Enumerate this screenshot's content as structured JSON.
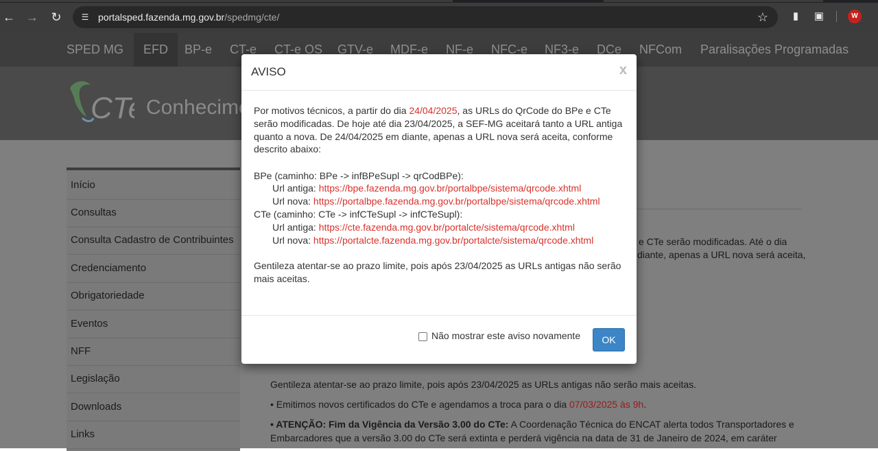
{
  "browser": {
    "url_host": "portalsped.fazenda.mg.gov.br",
    "url_path": "/spedmg/cte/",
    "avatar_letter": "W",
    "icons": [
      "back-icon",
      "forward-icon",
      "reload-icon",
      "site-settings-icon",
      "bookmark-star-icon",
      "extension-icon",
      "puzzle-icon"
    ]
  },
  "sitenav": {
    "items": [
      "SPED MG",
      "EFD",
      "BP-e",
      "CT-e",
      "CT-e OS",
      "GTV-e",
      "MDF-e",
      "NF-e",
      "NFC-e",
      "NF3-e",
      "DCe",
      "NFCom",
      "Paralisações Programadas"
    ]
  },
  "header": {
    "logo_text": "CTe",
    "title": "Conhecime"
  },
  "sidebar": {
    "items": [
      "Início",
      "Consultas",
      "Consulta Cadastro de Contribuintes",
      "Credenciamento",
      "Obrigatoriedade",
      "Eventos",
      "NFF",
      "Legislação",
      "Downloads",
      "Links"
    ]
  },
  "main": {
    "bg_line1": "e CTe serão modificadas. Até o dia",
    "bg_line2": "diante, apenas a URL nova será aceita,",
    "gentileza": "Gentileza atentar-se ao prazo limite, pois após 23/04/2025 as URLs antigas não serão mais aceitas.",
    "cert_prefix": "• Emitimos novos certificados do CTe e agendamos a troca para o dia ",
    "cert_date": "07/03/2025 às 9h",
    "cert_suffix": ".",
    "atencao_bold": "• ATENÇÃO: Fim da Vigência da Versão 3.00 do CTe:",
    "atencao_rest": " A Coordenação Técnica do ENCAT alerta todos Transportadores e",
    "atencao_line2": "Embarcadores que a versão 3.00 do CTe será extinta e perderá vigência na data de 31 de Janeiro de 2024, em caráter"
  },
  "modal": {
    "title": "AVISO",
    "close": "x",
    "p1_a": "Por motivos técnicos, a partir do dia ",
    "p1_date": "24/04/2025",
    "p1_b": ", as URLs do QrCode do BPe e CTe",
    "p1_line2": "serão modificadas. De hoje até dia 23/04/2025, a SEF-MG aceitará tanto a URL antiga",
    "p1_line3": "quanto a nova. De 24/04/2025 em diante, apenas a URL nova será aceita, conforme",
    "p1_line4": "descrito abaixo:",
    "bpe_head": "BPe (caminho: BPe -> infBPeSupl -> qrCodBPe):",
    "old_label": "Url antiga: ",
    "new_label": "Url nova: ",
    "bpe_old": "https://bpe.fazenda.mg.gov.br/portalbpe/sistema/qrcode.xhtml",
    "bpe_new": "https://portalbpe.fazenda.mg.gov.br/portalbpe/sistema/qrcode.xhtml",
    "cte_head": "CTe (caminho: CTe -> infCTeSupl -> infCTeSupl):",
    "cte_old": "https://cte.fazenda.mg.gov.br/portalcte/sistema/qrcode.xhtml",
    "cte_new": "https://portalcte.fazenda.mg.gov.br/portalcte/sistema/qrcode.xhtml",
    "p3_line1": "Gentileza atentar-se ao prazo limite, pois após 23/04/2025 as URLs antigas não serão",
    "p3_line2": "mais aceitas.",
    "checkbox_label": "Não mostrar este aviso novamente",
    "checkbox_checked": false,
    "ok_label": "OK"
  }
}
